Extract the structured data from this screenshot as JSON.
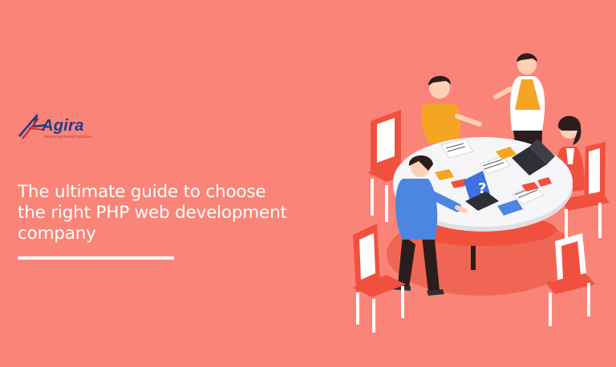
{
  "brand": {
    "name": "Agira",
    "tagline": "delivering desired solutions",
    "logo_colors": {
      "blue": "#1d3f8c",
      "red": "#c0272d"
    }
  },
  "headline": {
    "lines": [
      "The ultimate guide to choose",
      "the right PHP web development",
      "company"
    ]
  },
  "illustration": {
    "screen_symbol": "?"
  },
  "colors": {
    "background": "#fa8477",
    "text": "#ffffff"
  }
}
